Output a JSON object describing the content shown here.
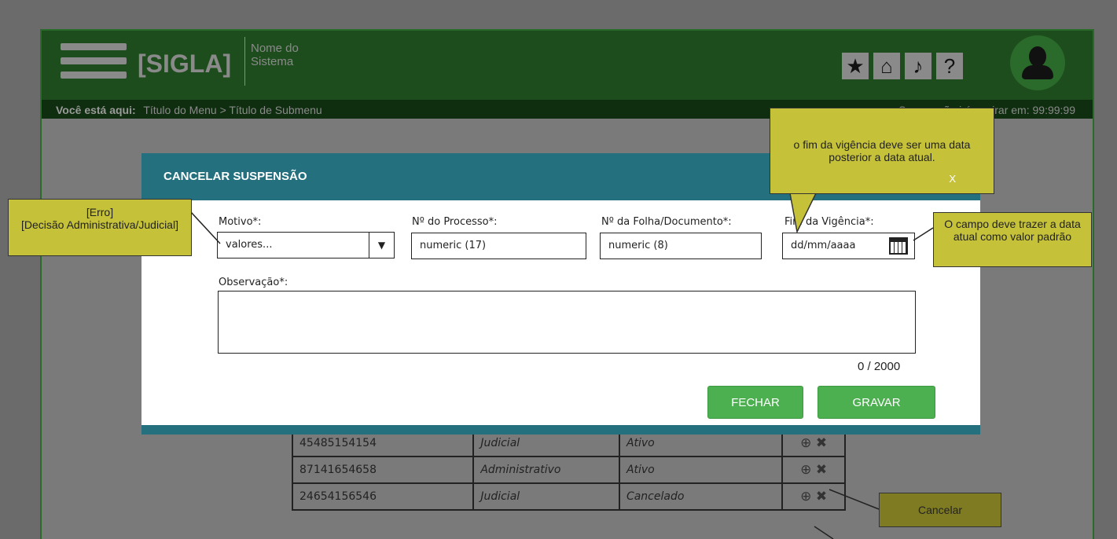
{
  "header": {
    "sigla": "[SIGLA]",
    "system_name": "Nome do Sistema",
    "breadcrumb_prefix": "Você está aqui:",
    "breadcrumb": "Título do Menu > Título de Submenu",
    "session": "Sua sessão irá expirar em: 99:99:99",
    "icons": [
      "star-icon",
      "home-icon",
      "bell-icon",
      "help-icon",
      "user-avatar-icon"
    ]
  },
  "table": {
    "rows": [
      {
        "processo": "45485154154",
        "tipo": "Judicial",
        "status": "Ativo"
      },
      {
        "processo": "87141654658",
        "tipo": "Administrativo",
        "status": "Ativo"
      },
      {
        "processo": "24654156546",
        "tipo": "Judicial",
        "status": "Cancelado"
      }
    ]
  },
  "modal": {
    "title": "CANCELAR SUSPENSÃO",
    "motivo_label": "Motivo*:",
    "motivo_value": "valores...",
    "processo_label": "Nº do Processo*:",
    "processo_value": "numeric (17)",
    "folha_label": "Nº da Folha/Documento*:",
    "folha_value": "numeric (8)",
    "vigencia_label": "Fim da Vigência*:",
    "vigencia_value": "dd/mm/aaaa",
    "observacao_label": "Observação*:",
    "counter": "0 / 2000",
    "fechar_label": "FECHAR",
    "gravar_label": "GRAVAR"
  },
  "notes": {
    "motivo": "[Erro]\n[Decisão Administrativa/Judicial]",
    "vigencia_rule": "o fim da vigência deve ser uma data posterior a data atual.",
    "vigencia_close": "X",
    "vigencia_default": "O campo deve trazer a data atual como valor padrão",
    "cancelar": "Cancelar"
  },
  "colors": {
    "header_green": "#1d4d1d",
    "modal_teal": "#25707e",
    "button_green": "#4caf50",
    "note_yellow": "#c5c23a"
  }
}
